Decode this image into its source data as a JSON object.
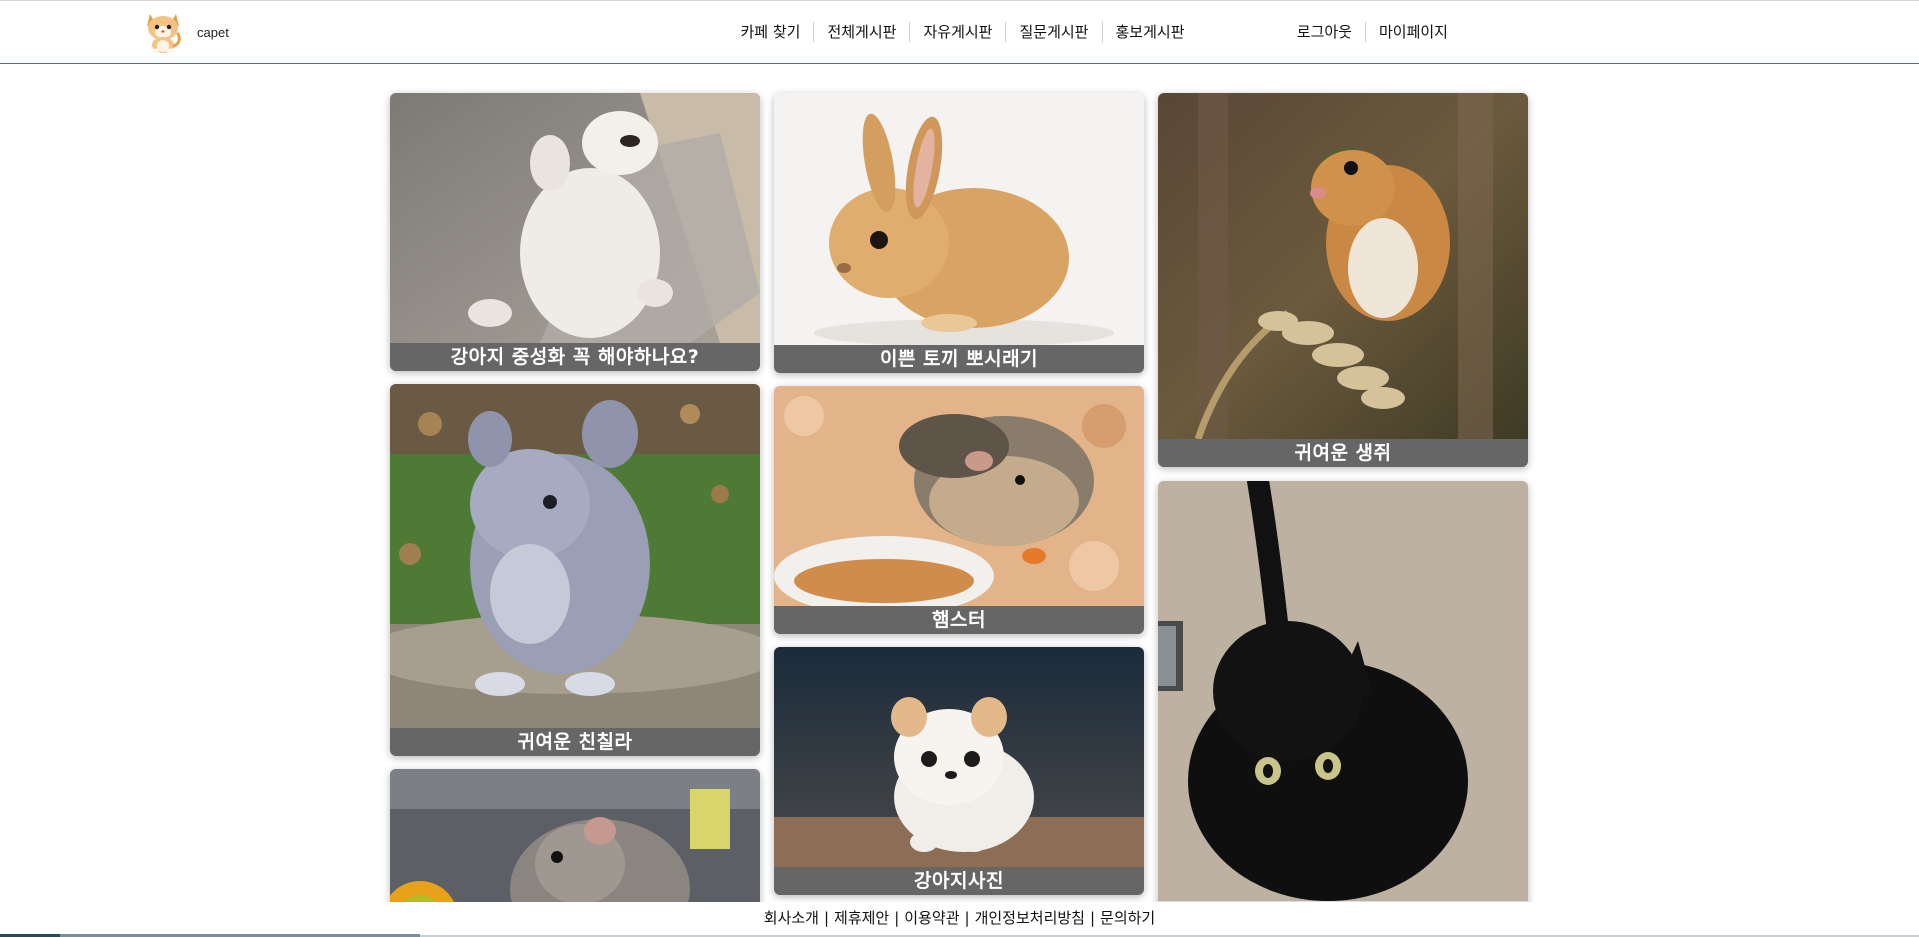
{
  "brand": {
    "name": "capet",
    "logo_icon": "cat-mascot-icon"
  },
  "nav": {
    "items": [
      {
        "label": "카페 찾기"
      },
      {
        "label": "전체게시판"
      },
      {
        "label": "자유게시판"
      },
      {
        "label": "질문게시판"
      },
      {
        "label": "홍보게시판"
      }
    ]
  },
  "user_nav": {
    "logout": "로그아웃",
    "mypage": "마이페이지"
  },
  "posts": [
    {
      "title": "강아지 중성화 꼭 해야하나요?",
      "image": "white-puppy-on-back-photo"
    },
    {
      "title": "이쁜 토끼 뽀시래기",
      "image": "orange-bunny-photo"
    },
    {
      "title": "귀여운 생쥐",
      "image": "harvest-mouse-on-wheat-photo"
    },
    {
      "title": "귀여운 친칠라",
      "image": "grey-chinchilla-photo"
    },
    {
      "title": "햄스터",
      "image": "hamster-eating-photo"
    },
    {
      "title": "",
      "image": "black-cat-photo"
    },
    {
      "title": "강아지사진",
      "image": "cartoon-puppy-photo"
    },
    {
      "title": "",
      "image": "hamster-with-kiwi-photo"
    }
  ],
  "footer": {
    "links": [
      "회사소개",
      "제휴제안",
      "이용약관",
      "개인정보처리방침",
      "문의하기"
    ]
  },
  "colors": {
    "caption_bg": "#666666",
    "header_border": "#2e7d8c"
  }
}
